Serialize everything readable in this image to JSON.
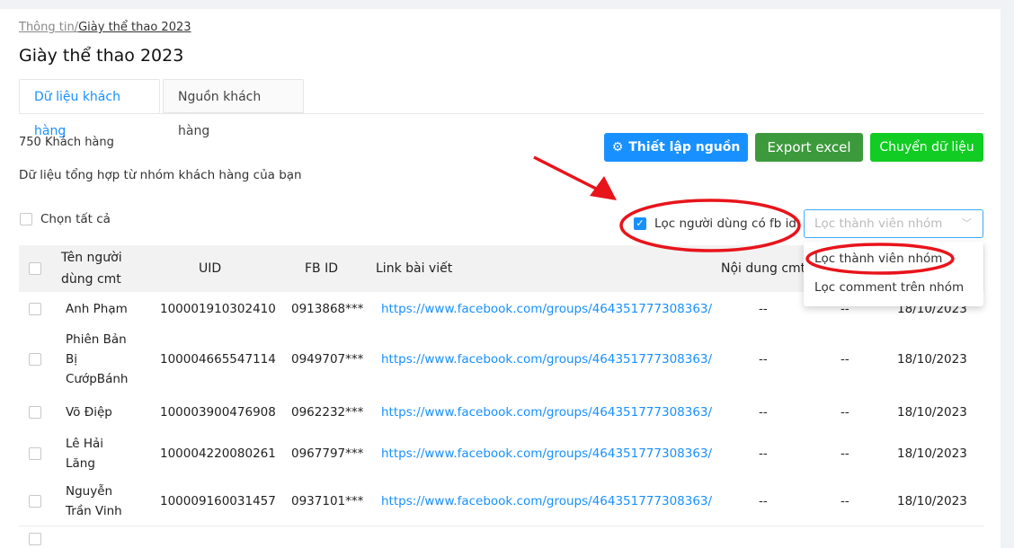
{
  "breadcrumb": {
    "parent": "Thông tin/",
    "current": "Giày thể thao 2023"
  },
  "page_title": "Giày thể thao 2023",
  "tabs": [
    {
      "label": "Dữ liệu khách hàng",
      "active": true
    },
    {
      "label": "Nguồn khách hàng",
      "active": false
    }
  ],
  "summary": {
    "count": "750 Khách hàng",
    "description": "Dữ liệu tổng hợp từ nhóm khách hàng của bạn"
  },
  "buttons": {
    "setup_source": "Thiết lập nguồn",
    "export_excel": "Export excel",
    "transfer_data": "Chuyển dữ liệu"
  },
  "select_all_label": "Chọn tất cả",
  "filter": {
    "checkbox_label": "Lọc người dùng có fb id",
    "checked": true,
    "select_placeholder": "Lọc thành viên nhóm",
    "options": [
      "Lọc thành viên nhóm",
      "Lọc comment trên nhóm"
    ]
  },
  "table": {
    "headers": {
      "name_line1": "Tên người",
      "name_line2": "dùng cmt",
      "uid": "UID",
      "fbid": "FB ID",
      "link": "Link bài viết",
      "content": "Nội dung cmt"
    },
    "rows": [
      {
        "name": [
          "Anh Phạm"
        ],
        "uid": "100001910302410",
        "fbid": "0913868***",
        "link": "https://www.facebook.com/groups/464351777308363/",
        "content": "--",
        "extra": "--",
        "date": "18/10/2023"
      },
      {
        "name": [
          "Phiên Bản",
          "Bị",
          "CướpBánh"
        ],
        "uid": "100004665547114",
        "fbid": "0949707***",
        "link": "https://www.facebook.com/groups/464351777308363/",
        "content": "--",
        "extra": "--",
        "date": "18/10/2023"
      },
      {
        "name": [
          "Võ Điệp"
        ],
        "uid": "100003900476908",
        "fbid": "0962232***",
        "link": "https://www.facebook.com/groups/464351777308363/",
        "content": "--",
        "extra": "--",
        "date": "18/10/2023"
      },
      {
        "name": [
          "Lê Hải",
          "Lăng"
        ],
        "uid": "100004220080261",
        "fbid": "0967797***",
        "link": "https://www.facebook.com/groups/464351777308363/",
        "content": "--",
        "extra": "--",
        "date": "18/10/2023"
      },
      {
        "name": [
          "Nguyễn",
          "Trần Vinh"
        ],
        "uid": "100009160031457",
        "fbid": "0937101***",
        "link": "https://www.facebook.com/groups/464351777308363/",
        "content": "--",
        "extra": "--",
        "date": "18/10/2023"
      }
    ]
  },
  "colors": {
    "primary": "#1890ff",
    "export_green": "#3c9a3c",
    "transfer_green": "#11cc22",
    "annotation_red": "#e8141b"
  }
}
